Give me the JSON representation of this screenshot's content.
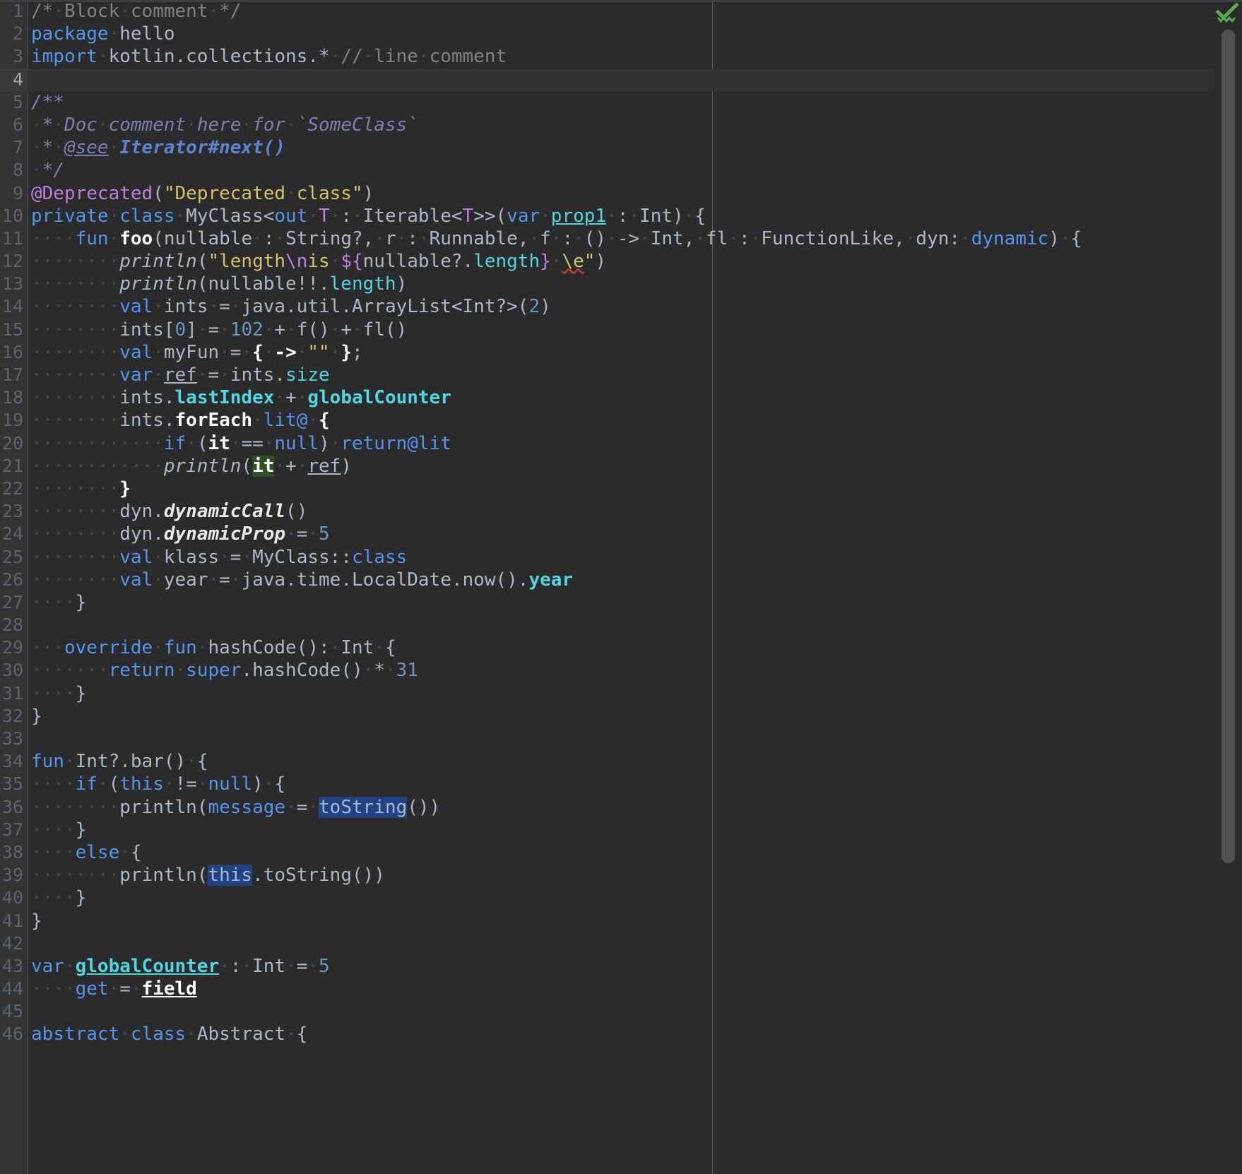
{
  "editor": {
    "language": "Kotlin",
    "theme": "Darcula",
    "first_line": 1,
    "last_line": 46,
    "right_margin_column": 120,
    "status_icon": "inspection-ok-checkmark",
    "colors": {
      "background": "#2b2b2b",
      "gutter": "#313335",
      "caret_line": "#323232",
      "line_number": "#606366",
      "default_text": "#a9b7c6",
      "keyword": "#5394ec",
      "string": "#cfc36b",
      "number": "#6897bb",
      "comment": "#808080",
      "doc_comment": "#7a7fb0",
      "annotation": "#bb7fdd",
      "property": "#4fd6e0",
      "identifier_under_caret": "#2f4f25",
      "selection_highlight": "#214283",
      "error_squiggle": "#bc3f3c",
      "status_ok": "#4e9a3f",
      "scrollbar_thumb": "#4e5052",
      "margin_guide": "#5a5a5a"
    }
  },
  "lines": [
    {
      "n": 1,
      "text": "/* Block comment */"
    },
    {
      "n": 2,
      "text": "package hello"
    },
    {
      "n": 3,
      "text": "import kotlin.collections.* // line comment"
    },
    {
      "n": 4,
      "text": "",
      "caret": true
    },
    {
      "n": 5,
      "text": "/**"
    },
    {
      "n": 6,
      "text": " * Doc comment here for `SomeClass`"
    },
    {
      "n": 7,
      "text": " * @see Iterator#next()"
    },
    {
      "n": 8,
      "text": " */"
    },
    {
      "n": 9,
      "text": "@Deprecated(\"Deprecated class\")"
    },
    {
      "n": 10,
      "text": "private class MyClass<out T : Iterable<T>>(var prop1 : Int) {"
    },
    {
      "n": 11,
      "text": "    fun foo(nullable : String?, r : Runnable, f : () -> Int, fl : FunctionLike, dyn: dynamic) {"
    },
    {
      "n": 12,
      "text": "        println(\"length\\nis ${nullable?.length} \\e\")"
    },
    {
      "n": 13,
      "text": "        println(nullable!!.length)"
    },
    {
      "n": 14,
      "text": "        val ints = java.util.ArrayList<Int?>(2)"
    },
    {
      "n": 15,
      "text": "        ints[0] = 102 + f() + fl()"
    },
    {
      "n": 16,
      "text": "        val myFun = { -> \"\" };"
    },
    {
      "n": 17,
      "text": "        var ref = ints.size"
    },
    {
      "n": 18,
      "text": "        ints.lastIndex + globalCounter"
    },
    {
      "n": 19,
      "text": "        ints.forEach lit@ {"
    },
    {
      "n": 20,
      "text": "            if (it == null) return@lit"
    },
    {
      "n": 21,
      "text": "            println(it + ref)"
    },
    {
      "n": 22,
      "text": "        }"
    },
    {
      "n": 23,
      "text": "        dyn.dynamicCall()"
    },
    {
      "n": 24,
      "text": "        dyn.dynamicProp = 5"
    },
    {
      "n": 25,
      "text": "        val klass = MyClass::class"
    },
    {
      "n": 26,
      "text": "        val year = java.time.LocalDate.now().year"
    },
    {
      "n": 27,
      "text": "    }"
    },
    {
      "n": 28,
      "text": ""
    },
    {
      "n": 29,
      "text": "    override fun hashCode(): Int {"
    },
    {
      "n": 30,
      "text": "        return super.hashCode() * 31"
    },
    {
      "n": 31,
      "text": "    }"
    },
    {
      "n": 32,
      "text": "}"
    },
    {
      "n": 33,
      "text": ""
    },
    {
      "n": 34,
      "text": "fun Int?.bar() {"
    },
    {
      "n": 35,
      "text": "    if (this != null) {"
    },
    {
      "n": 36,
      "text": "        println(message = toString())"
    },
    {
      "n": 37,
      "text": "    }"
    },
    {
      "n": 38,
      "text": "    else {"
    },
    {
      "n": 39,
      "text": "        println(this.toString())"
    },
    {
      "n": 40,
      "text": "    }"
    },
    {
      "n": 41,
      "text": "}"
    },
    {
      "n": 42,
      "text": ""
    },
    {
      "n": 43,
      "text": "var globalCounter : Int = 5"
    },
    {
      "n": 44,
      "text": "    get = field"
    },
    {
      "n": 45,
      "text": ""
    },
    {
      "n": 46,
      "text": "abstract class Abstract {"
    }
  ],
  "highlights": {
    "identifier_under_caret": "it",
    "selected_occurrences": [
      "toString",
      "this"
    ],
    "error_token": "\\e",
    "underlined_identifiers": [
      "prop1",
      "ref",
      "globalCounter",
      "field",
      "@see"
    ]
  }
}
